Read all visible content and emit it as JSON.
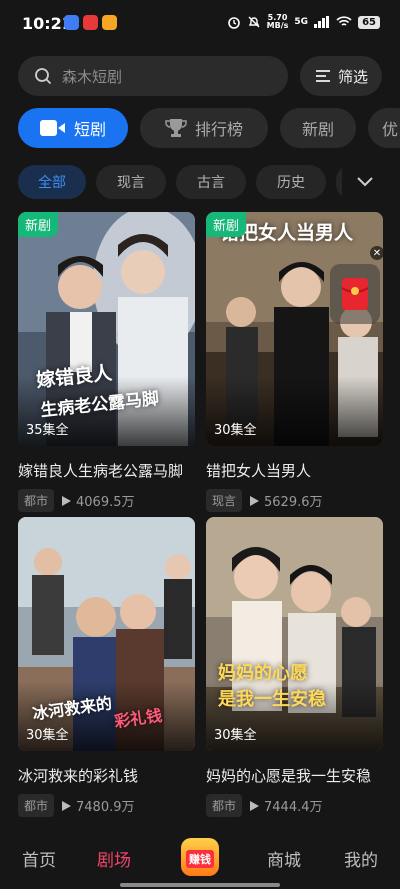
{
  "status": {
    "time": "10:21",
    "speed_value": "5.70",
    "speed_unit": "MB/s",
    "network": "5G",
    "battery": "65"
  },
  "search": {
    "placeholder": "森木短剧"
  },
  "filter": {
    "label": "筛选"
  },
  "tabs": [
    {
      "label": "短剧",
      "icon": "video-camera-icon",
      "active": true
    },
    {
      "label": "排行榜",
      "icon": "trophy-icon",
      "active": false
    },
    {
      "label": "新剧",
      "active": false
    },
    {
      "label": "优",
      "active": false
    }
  ],
  "chips": [
    {
      "label": "全部",
      "active": true
    },
    {
      "label": "现言"
    },
    {
      "label": "古言"
    },
    {
      "label": "历史"
    }
  ],
  "dramas": [
    {
      "badge": "新剧",
      "poster_title_1": "嫁错良人",
      "poster_title_2": "生病老公露马脚",
      "episodes": "35集全",
      "title": "嫁错良人生病老公露马脚",
      "genre": "都市",
      "plays": "4069.5万"
    },
    {
      "badge": "新剧",
      "poster_title_1": "错把女人当男人",
      "episodes": "30集全",
      "title": "错把女人当男人",
      "genre": "现言",
      "plays": "5629.6万"
    },
    {
      "poster_title_1": "冰河救来的",
      "poster_title_2": "彩礼钱",
      "episodes": "30集全",
      "title": "冰河救来的彩礼钱",
      "genre": "都市",
      "plays": "7480.9万"
    },
    {
      "poster_title_1": "妈妈的心愿",
      "poster_title_2": "是我一生安稳",
      "episodes": "30集全",
      "title": "妈妈的心愿是我一生安稳",
      "genre": "都市",
      "plays": "7444.4万"
    }
  ],
  "nav": {
    "home": "首页",
    "theater": "剧场",
    "earn": "赚钱",
    "mall": "商城",
    "mine": "我的"
  },
  "colors": {
    "accent_blue": "#1a73f0",
    "new_badge_green": "#16b87a",
    "nav_active": "#f0456a"
  }
}
